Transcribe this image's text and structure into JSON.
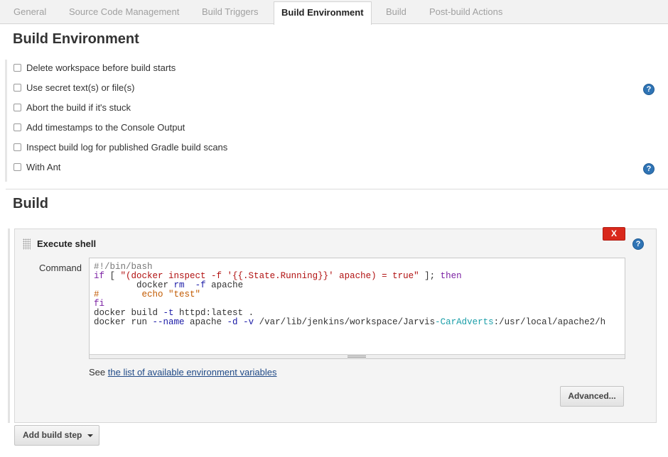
{
  "tabs": [
    {
      "label": "General"
    },
    {
      "label": "Source Code Management"
    },
    {
      "label": "Build Triggers"
    },
    {
      "label": "Build Environment",
      "active": true
    },
    {
      "label": "Build"
    },
    {
      "label": "Post-build Actions"
    }
  ],
  "build_environment": {
    "title": "Build Environment",
    "options": [
      {
        "label": "Delete workspace before build starts",
        "checked": false
      },
      {
        "label": "Use secret text(s) or file(s)",
        "checked": false
      },
      {
        "label": "Abort the build if it's stuck",
        "checked": false
      },
      {
        "label": "Add timestamps to the Console Output",
        "checked": false
      },
      {
        "label": "Inspect build log for published Gradle build scans",
        "checked": false
      },
      {
        "label": "With Ant",
        "checked": false
      }
    ]
  },
  "build": {
    "title": "Build",
    "step": {
      "title": "Execute shell",
      "delete_label": "X",
      "command_label": "Command",
      "command_lines": [
        "#!/bin/bash",
        "if [ \"(docker inspect -f '{{.State.Running}}' apache) = true\" ]; then",
        "        docker rm  -f apache",
        "#        echo \"test\"",
        "fi",
        "docker build -t httpd:latest .",
        "docker run --name apache -d -v /var/lib/jenkins/workspace/Jarvis-CarAdverts:/usr/local/apache2/h"
      ],
      "see_prefix": "See",
      "env_link": "the list of available environment variables",
      "advanced_label": "Advanced..."
    },
    "add_step_label": "Add build step"
  },
  "icons": {
    "help": "help-icon",
    "grip": "drag-handle-icon",
    "caret": "caret-down-icon"
  },
  "colors": {
    "help": "#2f74b5",
    "delete": "#d9291c",
    "link": "#204a87"
  }
}
